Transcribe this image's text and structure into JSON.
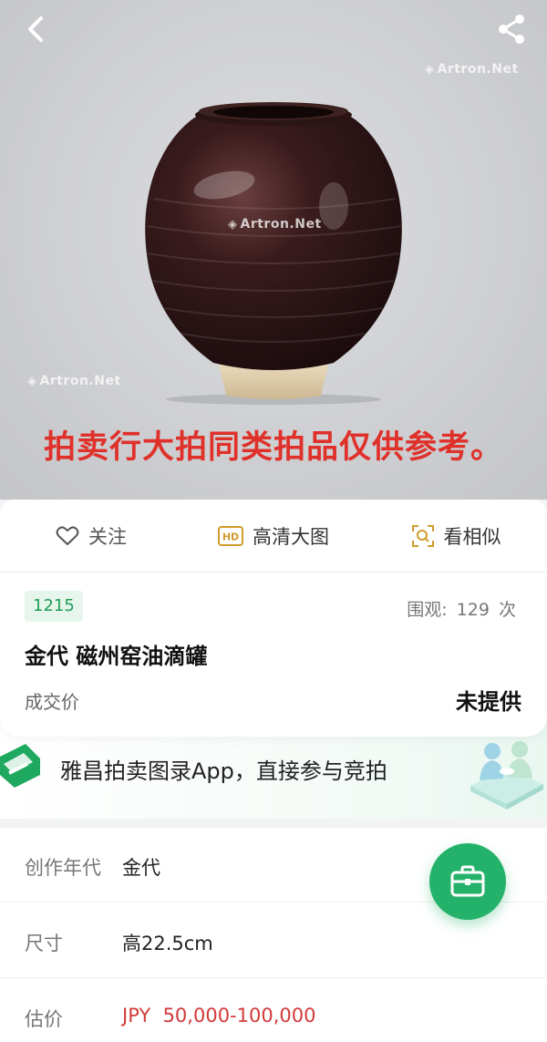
{
  "hero": {
    "watermark": "Artron.Net",
    "caption": "拍卖行大拍同类拍品仅供参考。"
  },
  "actions": {
    "follow_label": "关注",
    "hd_label": "高清大图",
    "hd_badge": "HD",
    "similar_label": "看相似"
  },
  "lot": {
    "number": "1215",
    "views_label": "围观:",
    "views_count": "129",
    "views_unit": "次",
    "title": "金代 磁州窑油滴罐",
    "price_label": "成交价",
    "price_value": "未提供"
  },
  "banner": {
    "text": "雅昌拍卖图录App，直接参与竞拍"
  },
  "details": [
    {
      "key": "创作年代",
      "value": "金代"
    },
    {
      "key": "尺寸",
      "value": "高22.5cm"
    },
    {
      "key": "估价",
      "value": "JPY  50,000-100,000"
    }
  ],
  "colors": {
    "accent_green": "#24b26b",
    "caption_red": "#e0302a",
    "estimate_red": "#d33a3a",
    "hd_gold": "#d09b2c"
  }
}
